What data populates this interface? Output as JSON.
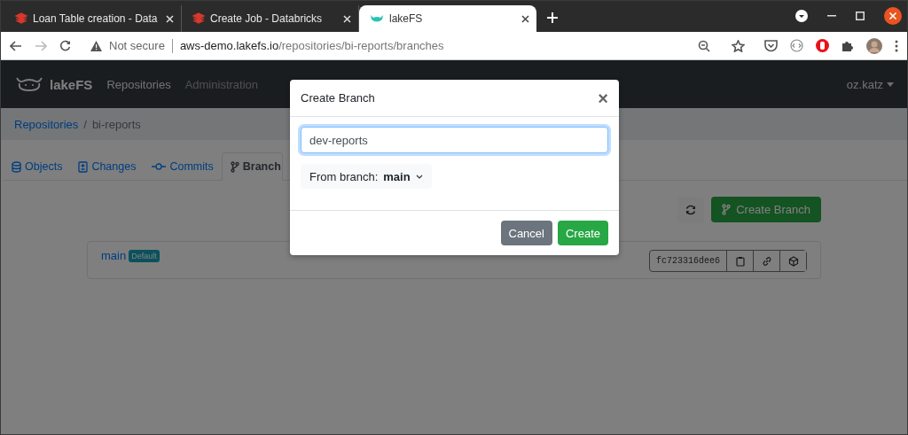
{
  "browser_tabs": [
    {
      "title": "Loan Table creation - Data",
      "selected": false
    },
    {
      "title": "Create Job - Databricks",
      "selected": false
    },
    {
      "title": "lakeFS",
      "selected": true
    }
  ],
  "address_bar": {
    "security": "Not secure",
    "host": "aws-demo.lakefs.io",
    "path": "/repositories/bi-reports/branches"
  },
  "navbar": {
    "brand": "lakeFS",
    "items": [
      {
        "label": "Repositories",
        "selected": true
      },
      {
        "label": "Administration",
        "selected": false
      }
    ],
    "user": "oz.katz"
  },
  "breadcrumb": {
    "link": "Repositories",
    "separator": "/",
    "current": "bi-reports"
  },
  "repo_tabs": [
    {
      "label": "Objects",
      "selected": false
    },
    {
      "label": "Changes",
      "selected": false
    },
    {
      "label": "Commits",
      "selected": false
    },
    {
      "label": "Branch",
      "selected": true
    }
  ],
  "create_branch_button": "Create Branch",
  "branches": [
    {
      "name": "main",
      "badge": "Default",
      "commit": "fc723316dee6"
    }
  ],
  "dialog": {
    "title": "Create Branch",
    "close": "×",
    "value": "dev-reports",
    "from_label": "From branch:",
    "from_branch": "main",
    "buttons": [
      {
        "label": "Cancel",
        "kind": "secondary"
      },
      {
        "label": "Create",
        "kind": "primary"
      }
    ]
  }
}
